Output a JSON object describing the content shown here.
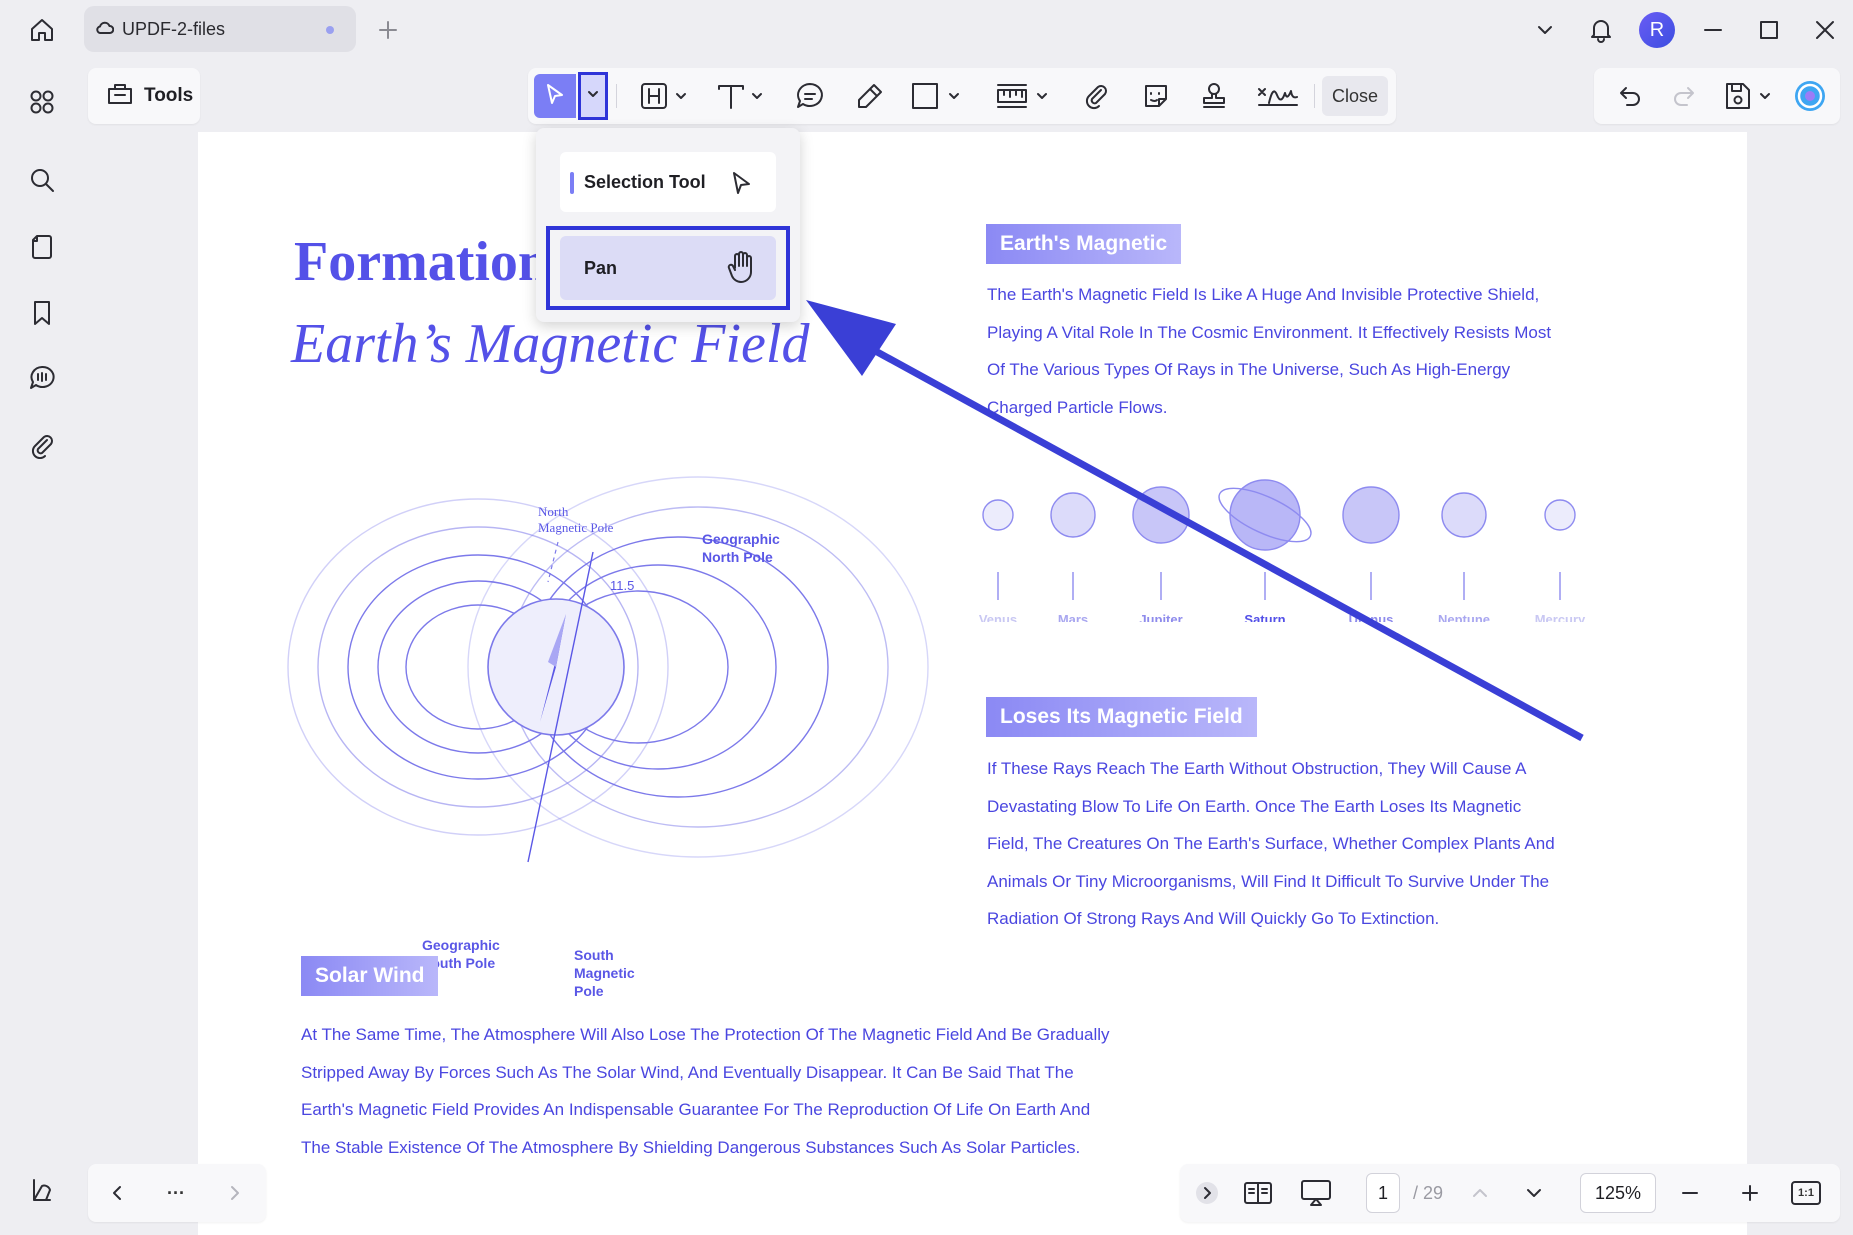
{
  "tab": {
    "title": "UPDF-2-files"
  },
  "user": {
    "avatar_letter": "R"
  },
  "toolbar": {
    "tools_label": "Tools",
    "close_label": "Close"
  },
  "dropdown": {
    "items": [
      {
        "label": "Selection Tool"
      },
      {
        "label": "Pan"
      }
    ]
  },
  "document": {
    "title_line1": "Formation",
    "title_line2": "Earth’s Magnetic Field",
    "sections": [
      {
        "heading": "Earth's Magnetic",
        "lines": [
          "The Earth's Magnetic Field Is Like A Huge And Invisible Protective Shield,",
          "Playing A Vital Role In The Cosmic Environment. It Effectively Resists Most",
          "Of The Various Types Of Rays in The Universe, Such As High-Energy",
          "Charged Particle Flows."
        ]
      },
      {
        "heading": "Loses Its Magnetic Field",
        "lines": [
          "If These Rays Reach The Earth Without Obstruction, They Will Cause A",
          "Devastating Blow To Life On Earth. Once The Earth Loses Its Magnetic",
          "Field, The Creatures On The Earth's Surface, Whether Complex Plants And",
          "Animals Or Tiny Microorganisms, Will Find It Difficult To Survive Under The",
          "Radiation Of Strong Rays And Will Quickly Go To Extinction."
        ]
      },
      {
        "heading": "Solar Wind",
        "lines": [
          "At The Same Time, The Atmosphere Will Also Lose The Protection Of The Magnetic Field And Be Gradually",
          "Stripped Away By Forces Such As The Solar Wind, And Eventually Disappear. It Can Be Said That The",
          "Earth's Magnetic Field Provides An Indispensable Guarantee For The Reproduction Of Life On Earth And",
          "The Stable Existence Of The Atmosphere By Shielding Dangerous Substances Such As Solar Particles."
        ]
      }
    ],
    "diagram_labels": {
      "north_magnetic_pole": [
        "North",
        "Magnetic Pole"
      ],
      "geographic_north_pole": [
        "Geographic",
        "North Pole"
      ],
      "geographic_south_pole": [
        "Geographic",
        "South Pole"
      ],
      "south_magnetic_pole": [
        "South",
        "Magnetic",
        "Pole"
      ],
      "tilt": "11.5"
    },
    "planets": [
      "Venus",
      "Mars",
      "Jupiter",
      "Saturn",
      "Uranus",
      "Neptune",
      "Mercury"
    ]
  },
  "statusbar": {
    "current_page": "1",
    "total_pages": "/ 29",
    "zoom": "125%",
    "nav_more": "···",
    "fit_label": "1:1"
  },
  "colors": {
    "accent": "#5451e8",
    "highlight": "#2f34d8",
    "badge": "#8b89f4"
  }
}
